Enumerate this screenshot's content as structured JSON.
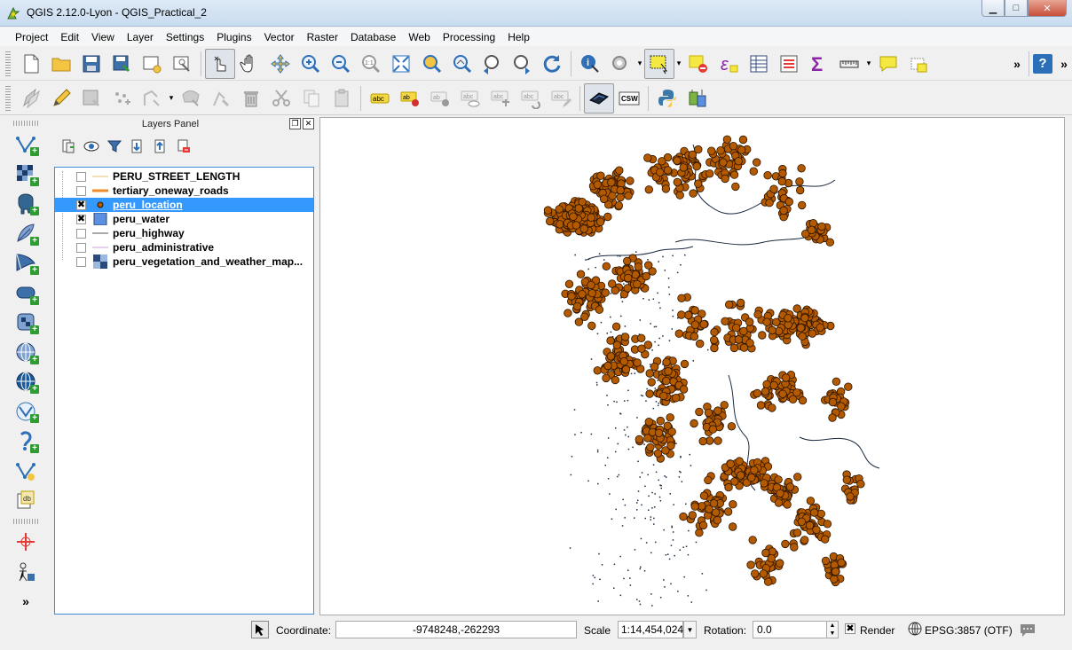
{
  "window": {
    "title": "QGIS 2.12.0-Lyon - QGIS_Practical_2",
    "app_icon": "qgis-logo-icon",
    "buttons": {
      "minimize": "▁",
      "maximize": "□",
      "close": "✕"
    }
  },
  "menu": [
    "Project",
    "Edit",
    "View",
    "Layer",
    "Settings",
    "Plugins",
    "Vector",
    "Raster",
    "Database",
    "Web",
    "Processing",
    "Help"
  ],
  "toolbar_overflow": "»",
  "layers_panel": {
    "title": "Layers Panel",
    "float_button": "❐",
    "close_button": "✕",
    "layers": [
      {
        "name": "PERU_STREET_LENGTH",
        "checked": false,
        "symbol": "line",
        "color": "#e6c36a"
      },
      {
        "name": "tertiary_oneway_roads",
        "checked": false,
        "symbol": "thick-line",
        "color": "#f08a24"
      },
      {
        "name": "peru_location",
        "checked": true,
        "symbol": "point",
        "color": "#b35900",
        "selected": true
      },
      {
        "name": "peru_water",
        "checked": true,
        "symbol": "fill",
        "color": "#5b8fe0"
      },
      {
        "name": "peru_highway",
        "checked": false,
        "symbol": "line",
        "color": "#555555"
      },
      {
        "name": "peru_administrative",
        "checked": false,
        "symbol": "line",
        "color": "#c8a4d8"
      },
      {
        "name": "peru_vegetation_and_weather_map...",
        "checked": false,
        "symbol": "raster",
        "color": "#2a4a7a"
      }
    ]
  },
  "map": {
    "point_fill": "#b35900",
    "point_stroke": "#2a1400",
    "river_color": "#1a2a40"
  },
  "status": {
    "coordinate_label": "Coordinate:",
    "coordinate_value": "-9748248,-262293",
    "scale_label": "Scale",
    "scale_value": "1:14,454,024",
    "rotation_label": "Rotation:",
    "rotation_value": "0.0",
    "render_label": "Render",
    "render_checked": true,
    "crs": "EPSG:3857 (OTF)"
  }
}
